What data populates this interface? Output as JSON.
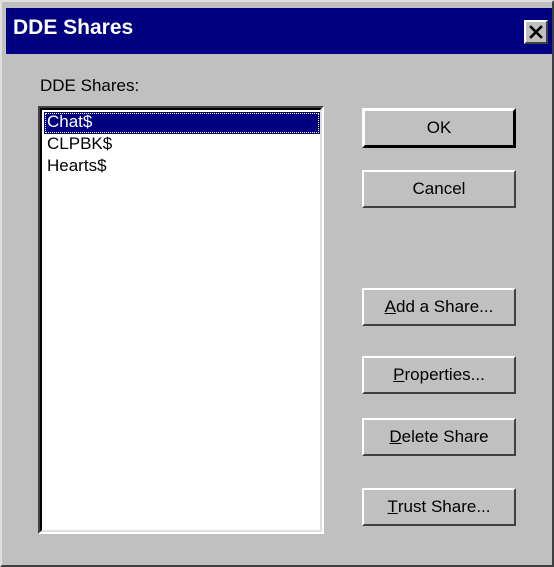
{
  "window": {
    "title": "DDE Shares",
    "close_glyph": "close-icon"
  },
  "list": {
    "label": "DDE Shares:",
    "items": [
      "Chat$",
      "CLPBK$",
      "Hearts$"
    ],
    "selected_index": 0
  },
  "buttons": {
    "ok": "OK",
    "cancel": "Cancel",
    "add_share": {
      "accel": "A",
      "rest": "dd a Share..."
    },
    "properties": {
      "accel": "P",
      "rest": "roperties..."
    },
    "delete_share": {
      "accel": "D",
      "rest": "elete Share"
    },
    "trust_share": {
      "accel": "T",
      "rest": "rust Share..."
    }
  },
  "colors": {
    "face": "#c0c0c0",
    "titlebar": "#000080",
    "selection": "#000080"
  }
}
